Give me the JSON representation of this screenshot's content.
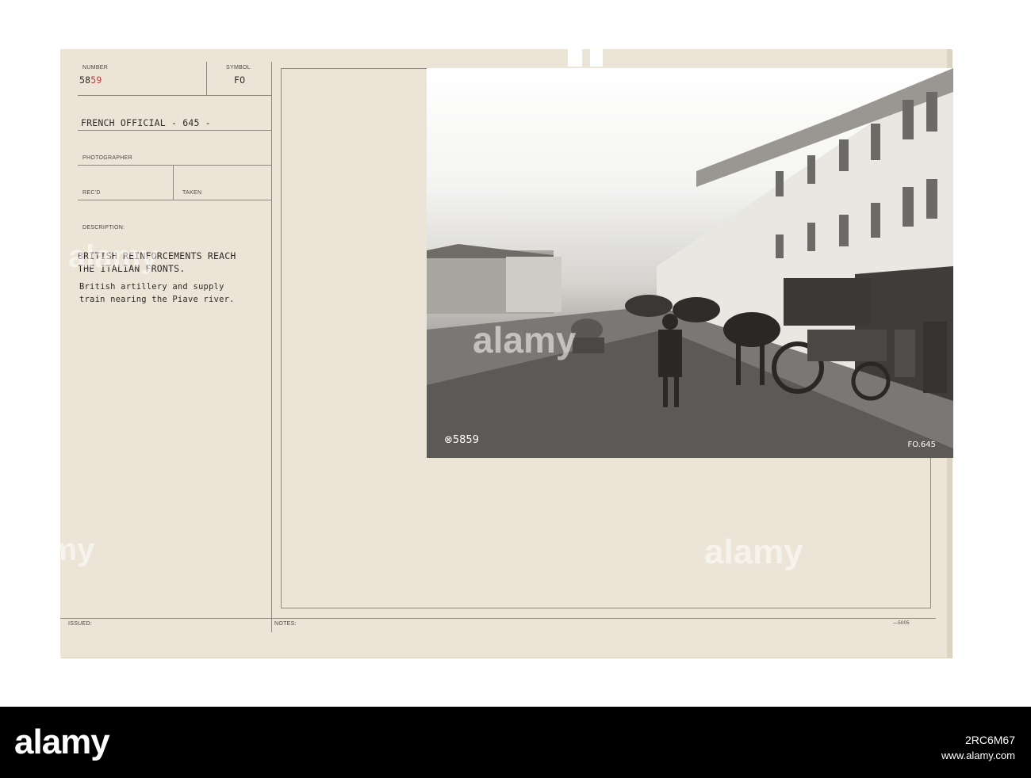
{
  "card": {
    "number_label": "NUMBER",
    "number_black": "58",
    "number_red": "59",
    "symbol_label": "SYMBOL",
    "symbol": "FO",
    "official": "FRENCH OFFICIAL - 645 -",
    "photographer_label": "PHOTOGRAPHER",
    "recd_label": "REC'D",
    "taken_label": "TAKEN",
    "description_label": "DESCRIPTION:",
    "title_line1": "BRITISH REINFORCEMENTS REACH",
    "title_line2": "THE ITALIAN FRONTS.",
    "desc_line1": "British artillery and supply",
    "desc_line2": "train nearing the Piave river.",
    "issued_label": "ISSUED:",
    "notes_label": "NOTES:",
    "form_code": "—5005"
  },
  "photo": {
    "number_stamp": "⊗5859",
    "code_stamp": "FO.645"
  },
  "watermark": {
    "text": "alamy"
  },
  "footer": {
    "logo": "alamy",
    "image_id_label": "Image ID: 2RC6M67",
    "image_id": "2RC6M67",
    "site": "www.alamy.com"
  }
}
